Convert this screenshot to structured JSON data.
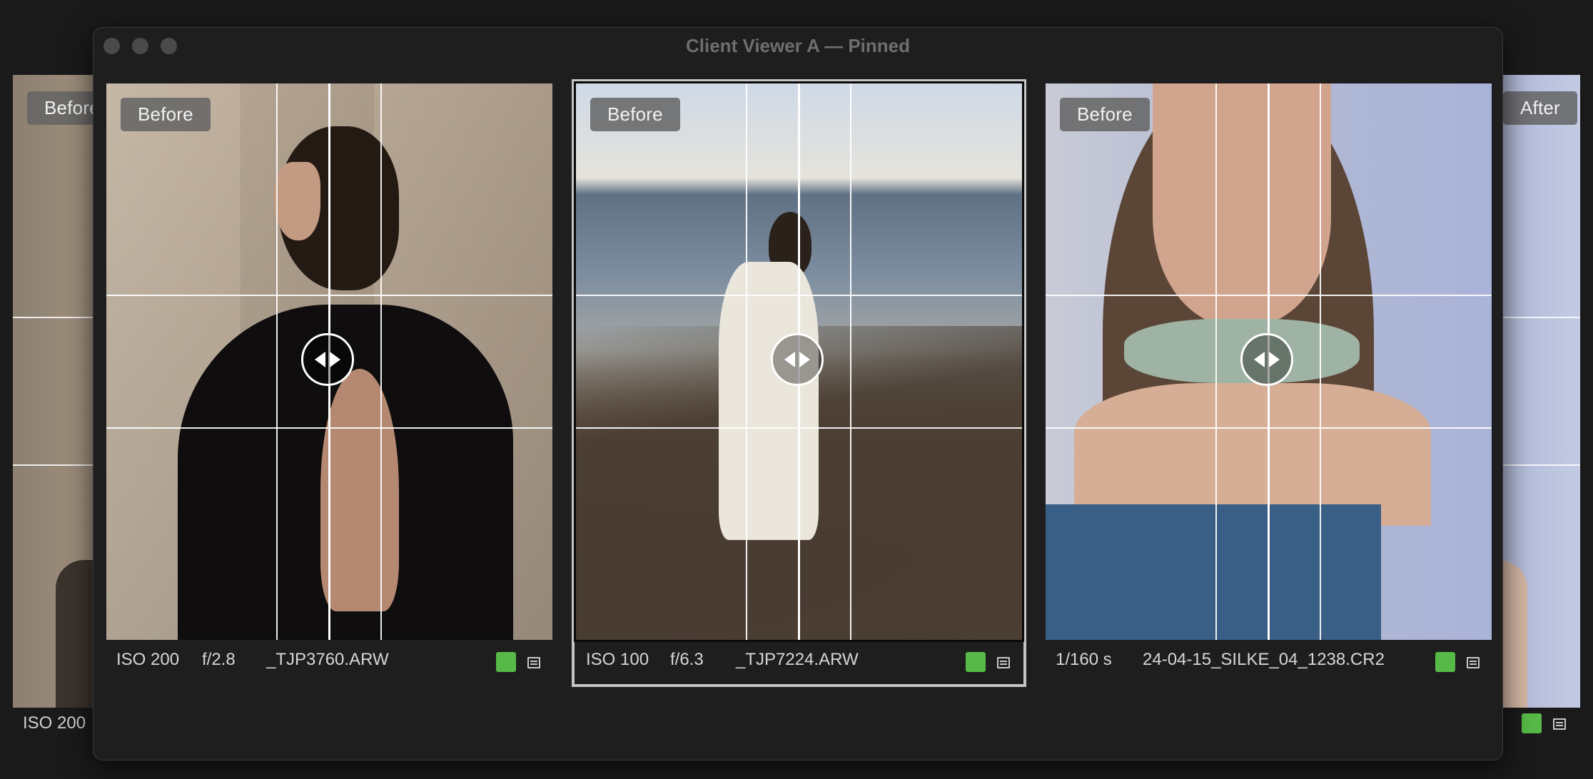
{
  "window": {
    "title": "Client Viewer A — Pinned"
  },
  "background_window": {
    "left_badge": "Before",
    "right_badge": "After",
    "left_meta_iso": "ISO 200"
  },
  "cells": [
    {
      "badge": "Before",
      "iso": "ISO 200",
      "aperture": "f/2.8",
      "filename": "_TJP3760.ARW",
      "flag_color": "#57b947",
      "selected": false
    },
    {
      "badge": "Before",
      "iso": "ISO 100",
      "aperture": "f/6.3",
      "filename": "_TJP7224.ARW",
      "flag_color": "#57b947",
      "selected": true
    },
    {
      "badge": "Before",
      "shutter": "1/160 s",
      "filename": "24-04-15_SILKE_04_1238.CR2",
      "flag_color": "#57b947",
      "selected": false
    }
  ],
  "icons": {
    "flag": "color-label-square-icon",
    "notes": "notes-list-icon",
    "split_handle": "before-after-slider-handle-icon"
  }
}
